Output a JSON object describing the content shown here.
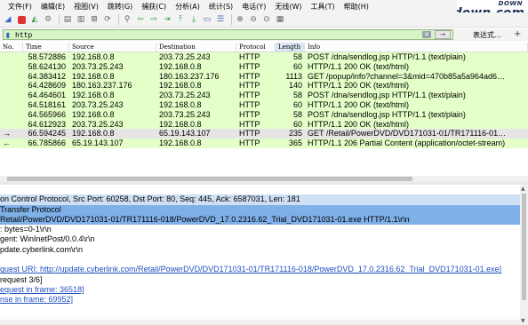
{
  "menu": [
    "文件(F)",
    "编辑(E)",
    "视图(V)",
    "跳转(G)",
    "捕获(C)",
    "分析(A)",
    "统计(S)",
    "电话(Y)",
    "无线(W)",
    "工具(T)",
    "帮助(H)"
  ],
  "logo": {
    "top": "DOWN",
    "main": "423down.com"
  },
  "toolbar_icons": [
    "shark-fin-icon",
    "stop-icon",
    "restart-icon",
    "options-gear-icon",
    "open-icon",
    "save-icon",
    "close-file-icon",
    "reload-icon",
    "find-icon",
    "go-back-icon",
    "go-forward-icon",
    "go-to-packet-icon",
    "go-first-icon",
    "go-last-icon",
    "autoscroll-icon",
    "colorize-icon",
    "zoom-in-icon",
    "zoom-out-icon",
    "zoom-reset-icon",
    "resize-columns-icon"
  ],
  "filter": {
    "value": "http",
    "apply_label": "→",
    "expression_label": "表达式…",
    "plus_label": "+"
  },
  "packet_list": {
    "columns": [
      "No.",
      "Time",
      "Source",
      "Destination",
      "Protocol",
      "Length",
      "Info"
    ],
    "rows": [
      {
        "no": "",
        "time": "58.572886",
        "src": "192.168.0.8",
        "dst": "203.73.25.243",
        "proto": "HTTP",
        "len": "58",
        "info": "POST /dna/sendlog.jsp HTTP/1.1  (text/plain)"
      },
      {
        "no": "",
        "time": "58.624130",
        "src": "203.73.25.243",
        "dst": "192.168.0.8",
        "proto": "HTTP",
        "len": "60",
        "info": "HTTP/1.1 200 OK  (text/html)"
      },
      {
        "no": "",
        "time": "64.383412",
        "src": "192.168.0.8",
        "dst": "180.163.237.176",
        "proto": "HTTP",
        "len": "1113",
        "info": "GET /popup/info?channel=3&mid=470b85a5a964ad6…"
      },
      {
        "no": "",
        "time": "64.428609",
        "src": "180.163.237.176",
        "dst": "192.168.0.8",
        "proto": "HTTP",
        "len": "140",
        "info": "HTTP/1.1 200 OK  (text/html)"
      },
      {
        "no": "",
        "time": "64.464601",
        "src": "192.168.0.8",
        "dst": "203.73.25.243",
        "proto": "HTTP",
        "len": "58",
        "info": "POST /dna/sendlog.jsp HTTP/1.1  (text/plain)"
      },
      {
        "no": "",
        "time": "64.518161",
        "src": "203.73.25.243",
        "dst": "192.168.0.8",
        "proto": "HTTP",
        "len": "60",
        "info": "HTTP/1.1 200 OK  (text/html)"
      },
      {
        "no": "",
        "time": "64.565966",
        "src": "192.168.0.8",
        "dst": "203.73.25.243",
        "proto": "HTTP",
        "len": "58",
        "info": "POST /dna/sendlog.jsp HTTP/1.1  (text/plain)"
      },
      {
        "no": "",
        "time": "64.612923",
        "src": "203.73.25.243",
        "dst": "192.168.0.8",
        "proto": "HTTP",
        "len": "60",
        "info": "HTTP/1.1 200 OK  (text/html)"
      },
      {
        "no": "→",
        "time": "66.594245",
        "src": "192.168.0.8",
        "dst": "65.19.143.107",
        "proto": "HTTP",
        "len": "235",
        "info": "GET /Retail/PowerDVD/DVD171031-01/TR171116-01…"
      },
      {
        "no": "←",
        "time": "66.785866",
        "src": "65.19.143.107",
        "dst": "192.168.0.8",
        "proto": "HTTP",
        "len": "365",
        "info": "HTTP/1.1 206 Partial Content  (application/octet-stream)"
      }
    ]
  },
  "details": [
    {
      "text": "",
      "style": ""
    },
    {
      "text": "on Control Protocol, Src Port: 60258, Dst Port: 80, Seq: 445, Ack: 6587031, Len: 181",
      "style": "sel"
    },
    {
      "text": "Transfer Protocol",
      "style": "hl"
    },
    {
      "text": "Retail/PowerDVD/DVD171031-01/TR171116-018/PowerDVD_17.0.2316.62_Trial_DVD171031-01.exe HTTP/1.1\\r\\n",
      "style": "hl"
    },
    {
      "text": ": bytes=0-1\\r\\n",
      "style": ""
    },
    {
      "text": "gent: WinInetPost/0.0.4\\r\\n",
      "style": ""
    },
    {
      "text": "pdate.cyberlink.com\\r\\n",
      "style": ""
    },
    {
      "text": "",
      "style": ""
    },
    {
      "text": "quest URI: http://update.cyberlink.com/Retail/PowerDVD/DVD171031-01/TR171116-018/PowerDVD_17.0.2316.62_Trial_DVD171031-01.exe]",
      "style": "link"
    },
    {
      "text": "request 3/6]",
      "style": ""
    },
    {
      "text": "equest in frame: 36518]",
      "style": "link"
    },
    {
      "text": "nse in frame: 69952]",
      "style": "link"
    }
  ],
  "colors": {
    "row_bg": "#e4ffc7",
    "selected_row_bg": "#e5e5e5",
    "filter_valid_bg": "#d7f5c4",
    "detail_highlight": "#7fb0e8",
    "link": "#1f4fc2"
  }
}
